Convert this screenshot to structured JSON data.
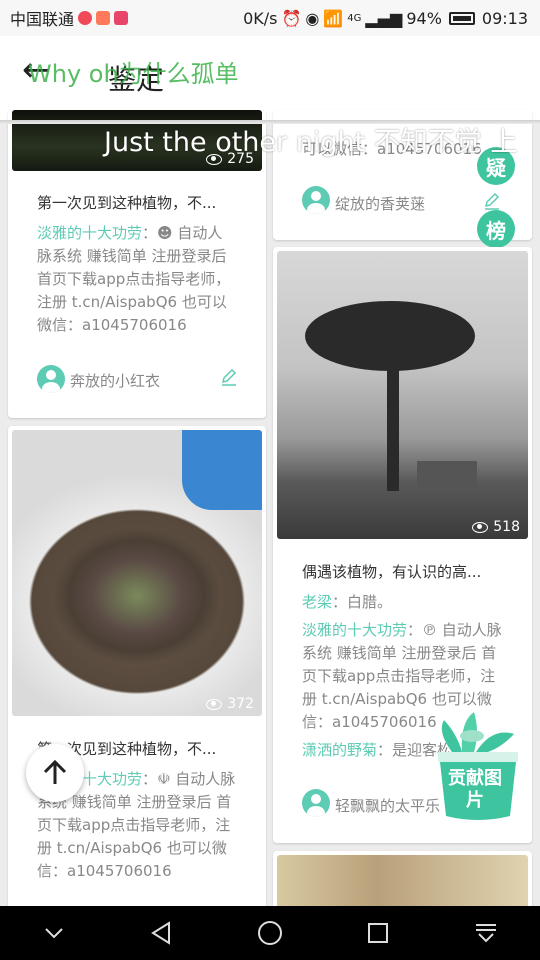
{
  "status_bar": {
    "carrier": "中国联通",
    "network_speed": "0K/s",
    "signal": "4G",
    "battery": "94%",
    "time": "09:13"
  },
  "header": {
    "title": "鉴定",
    "overlay_green": "Why oh为什么孤单",
    "overlay_white": "Just the other night 不知不觉 上"
  },
  "colors": {
    "accent": "#5ecbb4",
    "badge": "#3ec59f"
  },
  "side_badges": [
    "疑",
    "榜"
  ],
  "cards": {
    "top_right": {
      "body_partial": "可以微信：a1045706016",
      "user": "绽放的香荚蒾"
    },
    "top_left": {
      "views": "275",
      "title": "第一次见到这种植物，不...",
      "highlight": "淡雅的十大功劳",
      "body": "：☻ 自动人脉系统 赚钱简单 注册登录后 首页下载app点击指导老师，注册 t.cn/AispabQ6 也可以微信：a1045706016",
      "user": "奔放的小红衣"
    },
    "mid_right": {
      "views": "518",
      "title": "偶遇该植物，有认识的高...",
      "hl1": "老梁",
      "body1": "：白腊。",
      "hl2": "淡雅的十大功劳",
      "body2": "：℗ 自动人脉系统 赚钱简单 注册登录后 首页下载app点击指导老师，注册 t.cn/AispabQ6 也可以微信：a1045706016",
      "hl3": "潇洒的野菊",
      "body3": "：是迎客松",
      "user": "轻飘飘的太平乐"
    },
    "bottom_left": {
      "views": "372",
      "title": "第一次见到这种植物，不...",
      "highlight": "淡雅的十大功劳",
      "body": "：☫ 自动人脉系统 赚钱简单 注册登录后 首页下载app点击指导老师，注册 t.cn/AispabQ6 也可以微信：a1045706016"
    }
  },
  "contribute_button": "贡献图片",
  "back_to_top_icon": "arrow-up-icon"
}
